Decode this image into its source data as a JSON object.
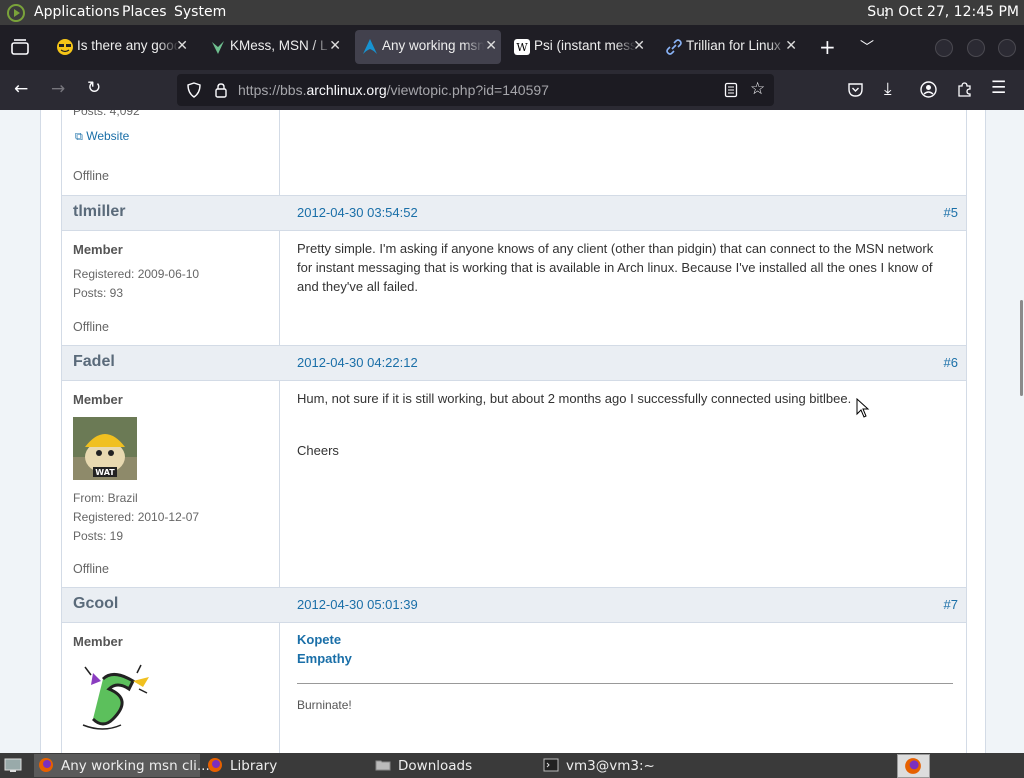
{
  "top_panel": {
    "menus": [
      "Applications",
      "Places",
      "System"
    ],
    "clock": "Sun Oct 27, 12:45 PM"
  },
  "tabs": [
    {
      "title": "Is there any good",
      "icon": "glasses-emoji-icon",
      "active": false
    },
    {
      "title": "KMess, MSN / L",
      "icon": "kmess-icon",
      "active": false
    },
    {
      "title": "Any working msn",
      "icon": "arch-linux-icon",
      "active": true
    },
    {
      "title": "Psi (instant mess",
      "icon": "wikipedia-icon",
      "active": false
    },
    {
      "title": "Trillian for Linux",
      "icon": "link-icon",
      "active": false
    }
  ],
  "navbar": {
    "url_prefix": "https://bbs.",
    "url_host": "archlinux.org",
    "url_path": "/viewtopic.php?id=140597"
  },
  "posts": {
    "prev": {
      "posts_count": "Posts: 4,092",
      "website": "Website",
      "status": "Offline"
    },
    "p5": {
      "author": "tlmiller",
      "date": "2012-04-30 03:54:52",
      "num": "#5",
      "role": "Member",
      "registered": "Registered: 2009-06-10",
      "posts": "Posts: 93",
      "status": "Offline",
      "body": "Pretty simple.  I'm asking if anyone knows of any client (other than pidgin) that can connect to the MSN network for instant messaging that is working that is available in Arch linux.  Because I've installed all the ones I know of and they've all failed."
    },
    "p6": {
      "author": "Fadel",
      "date": "2012-04-30 04:22:12",
      "num": "#6",
      "role": "Member",
      "avatar_text": "WAT",
      "from": "From: Brazil",
      "registered": "Registered: 2010-12-07",
      "posts": "Posts: 19",
      "status": "Offline",
      "body1": "Hum, not sure if it is still working, but about 2 months ago I successfully connected using bitlbee.",
      "body2": "Cheers"
    },
    "p7": {
      "author": "Gcool",
      "date": "2012-04-30 05:01:39",
      "num": "#7",
      "role": "Member",
      "link1": "Kopete",
      "link2": "Empathy",
      "signature": "Burninate!"
    }
  },
  "taskbar": {
    "items": [
      {
        "label": "Any working msn cli...",
        "icon": "firefox-icon",
        "active": true
      },
      {
        "label": "Library",
        "icon": "firefox-icon",
        "active": false
      },
      {
        "label": "Downloads",
        "icon": "folder-icon",
        "active": false
      },
      {
        "label": "vm3@vm3:~",
        "icon": "terminal-icon",
        "active": false
      }
    ]
  }
}
